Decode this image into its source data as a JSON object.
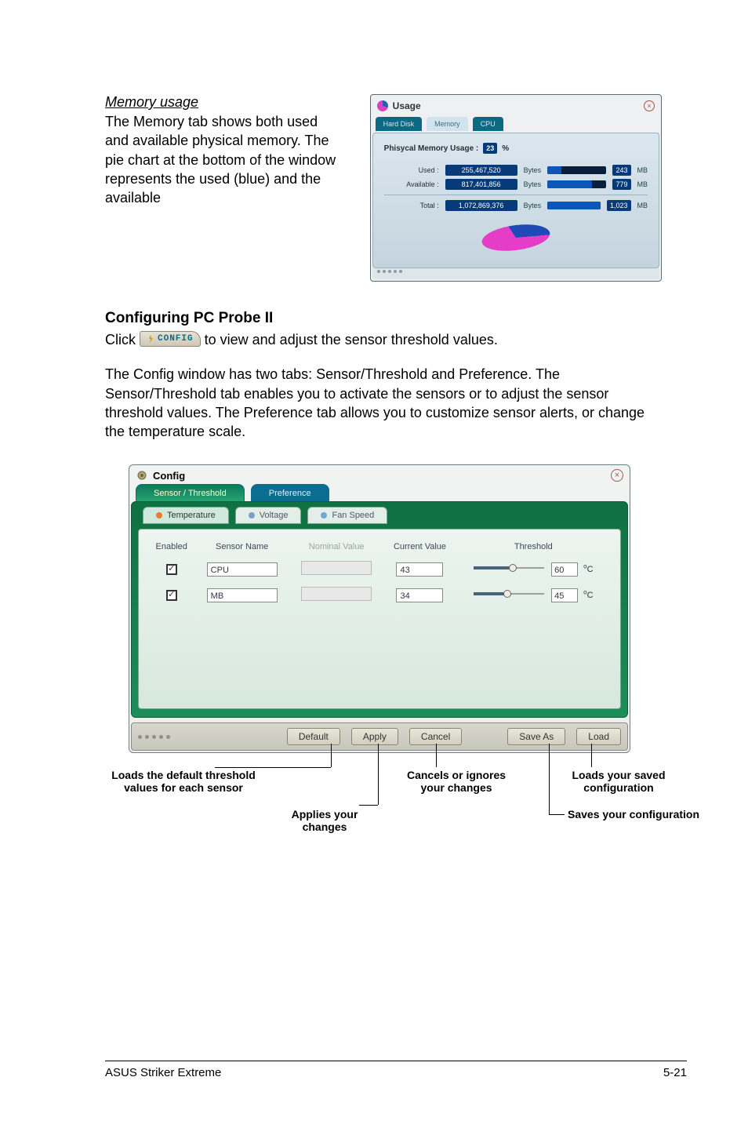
{
  "domain": "Document",
  "section1": {
    "subheading": "Memory usage",
    "desc": "The Memory tab shows both used and available physical memory. The pie chart at the bottom of the window represents the used (blue) and the available"
  },
  "usageWindow": {
    "title": "Usage",
    "tabs": [
      "Hard Disk",
      "Memory",
      "CPU"
    ],
    "activeTab": 1,
    "heading": "Phisycal Memory Usage :",
    "pctBadge": "23",
    "pctUnit": "%",
    "rows": [
      {
        "label": "Used :",
        "bytes": "255,467,520",
        "bytesUnit": "Bytes",
        "mb": "243",
        "mbUnit": "MB",
        "fillPct": 24
      },
      {
        "label": "Available :",
        "bytes": "817,401,856",
        "bytesUnit": "Bytes",
        "mb": "779",
        "mbUnit": "MB",
        "fillPct": 76
      },
      {
        "label": "Total :",
        "bytes": "1,072,869,376",
        "bytesUnit": "Bytes",
        "mb": "1,023",
        "mbUnit": "MB",
        "fillPct": 100
      }
    ]
  },
  "heading2": "Configuring PC Probe II",
  "clickLine_pre": "Click ",
  "clickLine_post": " to view and adjust the sensor threshold values.",
  "configChipLabel": "CONFIG",
  "para2": "The Config window has two tabs: Sensor/Threshold and Preference. The Sensor/Threshold tab enables you to activate the sensors or to adjust the sensor threshold values. The Preference tab allows you to customize sensor alerts, or change the temperature scale.",
  "configWindow": {
    "title": "Config",
    "mainTabs": [
      "Sensor / Threshold",
      "Preference"
    ],
    "activeMainTab": 0,
    "subTabs": [
      "Temperature",
      "Voltage",
      "Fan Speed"
    ],
    "activeSubTab": 0,
    "columns": [
      "Enabled",
      "Sensor Name",
      "Nominal Value",
      "Current Value",
      "Threshold"
    ],
    "rows": [
      {
        "enabled": true,
        "name": "CPU",
        "nominal": "",
        "current": "43",
        "threshold": "60",
        "unit": "°C",
        "sliderPct": 55
      },
      {
        "enabled": true,
        "name": "MB",
        "nominal": "",
        "current": "34",
        "threshold": "45",
        "unit": "°C",
        "sliderPct": 48
      }
    ],
    "buttons": {
      "default": "Default",
      "apply": "Apply",
      "cancel": "Cancel",
      "saveAs": "Save As",
      "load": "Load"
    }
  },
  "callouts": {
    "default": "Loads the default threshold values for each sensor",
    "apply": "Applies your changes",
    "cancel": "Cancels or ignores your changes",
    "load": "Loads your saved configuration",
    "save": "Saves your configuration"
  },
  "footer": {
    "left": "ASUS Striker Extreme",
    "right": "5-21"
  }
}
